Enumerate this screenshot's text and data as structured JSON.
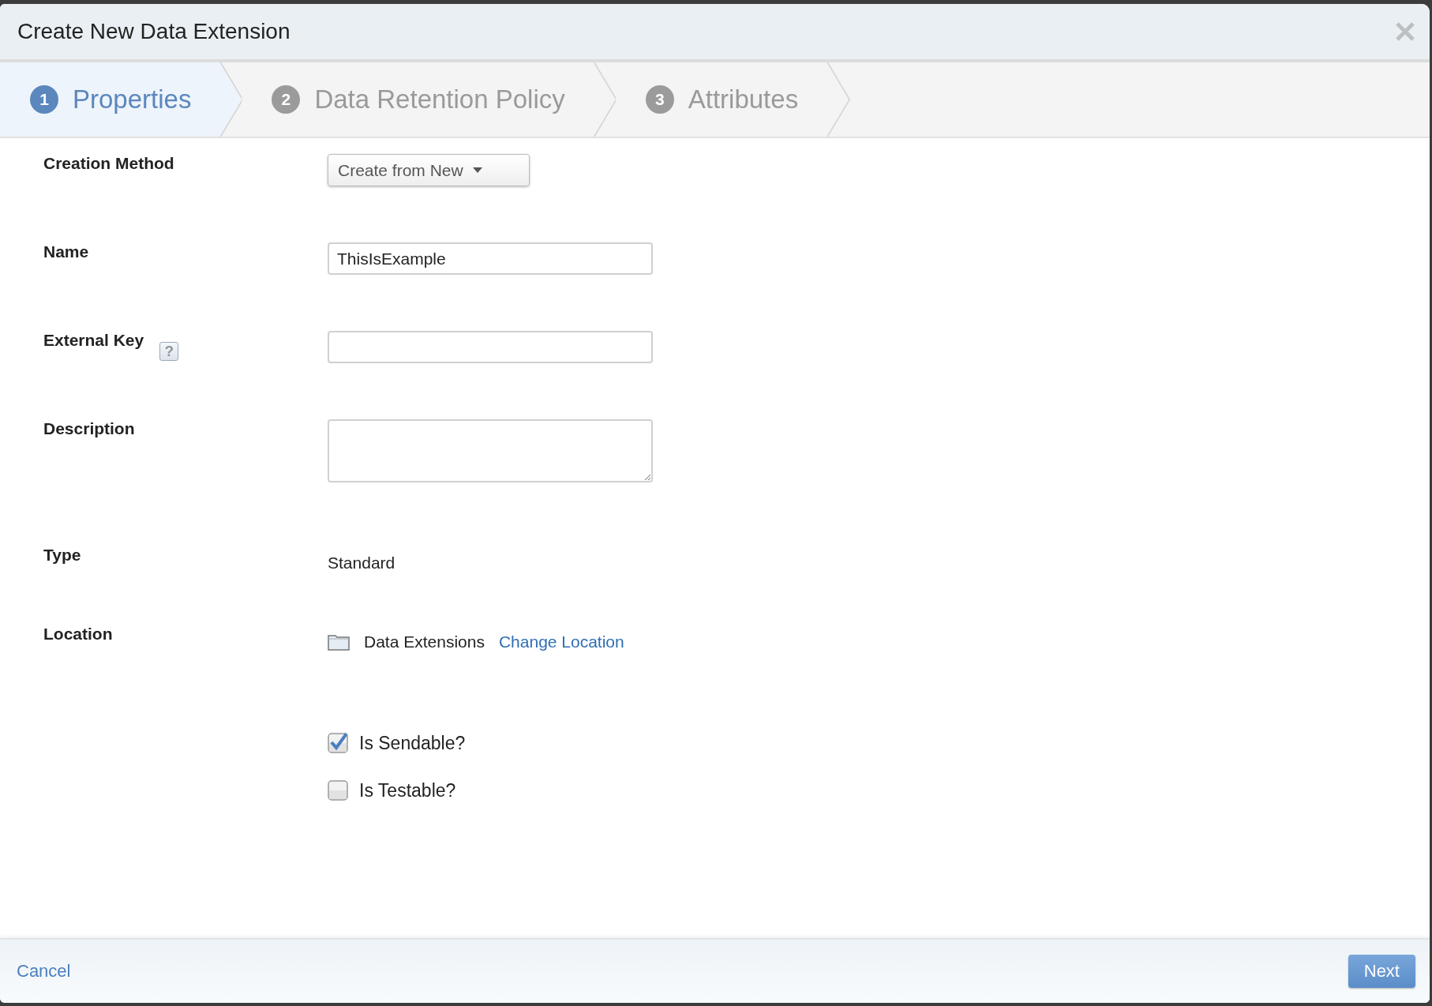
{
  "dialog": {
    "title": "Create New Data Extension"
  },
  "steps": [
    {
      "number": "1",
      "label": "Properties",
      "selected": true
    },
    {
      "number": "2",
      "label": "Data Retention Policy",
      "selected": false
    },
    {
      "number": "3",
      "label": "Attributes",
      "selected": false
    }
  ],
  "fields": [
    {
      "kind": "dropdown",
      "label": "Creation Method",
      "value": "Create from New"
    },
    {
      "kind": "text",
      "label": "Name",
      "value": "ThisIsExample"
    },
    {
      "kind": "text",
      "label": "External Key",
      "help": "?"
    },
    {
      "kind": "textarea",
      "label": "Description"
    },
    {
      "kind": "static",
      "label": "Type",
      "value": "Standard"
    },
    {
      "kind": "location",
      "label": "Location",
      "value": "Data Extensions",
      "link": "Change Location"
    }
  ],
  "options": [
    {
      "label": "Is Sendable?",
      "checked": true
    },
    {
      "label": "Is Testable?",
      "checked": false
    }
  ],
  "footer": {
    "cancel": "Cancel",
    "next": "Next"
  }
}
